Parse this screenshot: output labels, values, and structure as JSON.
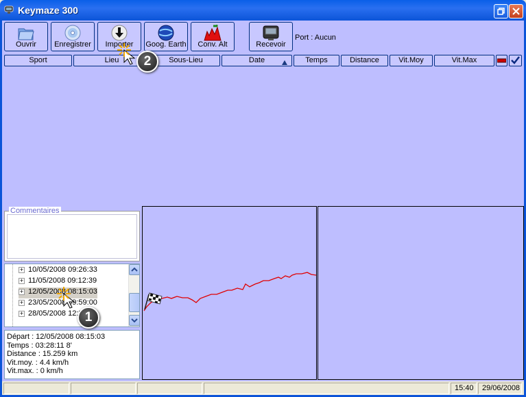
{
  "window": {
    "title": "Keymaze 300"
  },
  "toolbar": {
    "buttons": [
      {
        "label": "Ouvrir",
        "icon": "folder-icon"
      },
      {
        "label": "Enregistrer",
        "icon": "cd-icon"
      },
      {
        "label": "Importer",
        "icon": "import-icon"
      },
      {
        "label": "Goog. Earth",
        "icon": "globe-icon"
      },
      {
        "label": "Conv. Alt",
        "icon": "altitude-icon"
      },
      {
        "label": "Recevoir",
        "icon": "device-icon"
      }
    ],
    "port_label": "Port : Aucun"
  },
  "columns": [
    "Sport",
    "Lieu",
    "Sous-Lieu",
    "Date",
    "Temps",
    "Distance",
    "Vit.Moy",
    "Vit.Max"
  ],
  "comments": {
    "legend": "Commentaires"
  },
  "tree": {
    "items": [
      "10/05/2008 09:26:33",
      "11/05/2008 09:12:39",
      "12/05/2008 08:15:03",
      "23/05/2008 09:59:00",
      "28/05/2008 12:37"
    ],
    "selected_index": 2
  },
  "info": {
    "lines": [
      "Départ : 12/05/2008 08:15:03",
      "Temps : 03:28:11 8'",
      "Distance : 15.259 km",
      "Vit.moy. : 4.4 km/h",
      "Vit.max. : 0 km/h"
    ]
  },
  "status": {
    "time": "15:40",
    "date": "29/06/2008"
  },
  "callouts": [
    "1",
    "2"
  ],
  "colors": {
    "client_bg": "#bebeff",
    "button_bg": "#c8c8ff",
    "track": "#e00000",
    "titlebar": "#0b54d8"
  }
}
